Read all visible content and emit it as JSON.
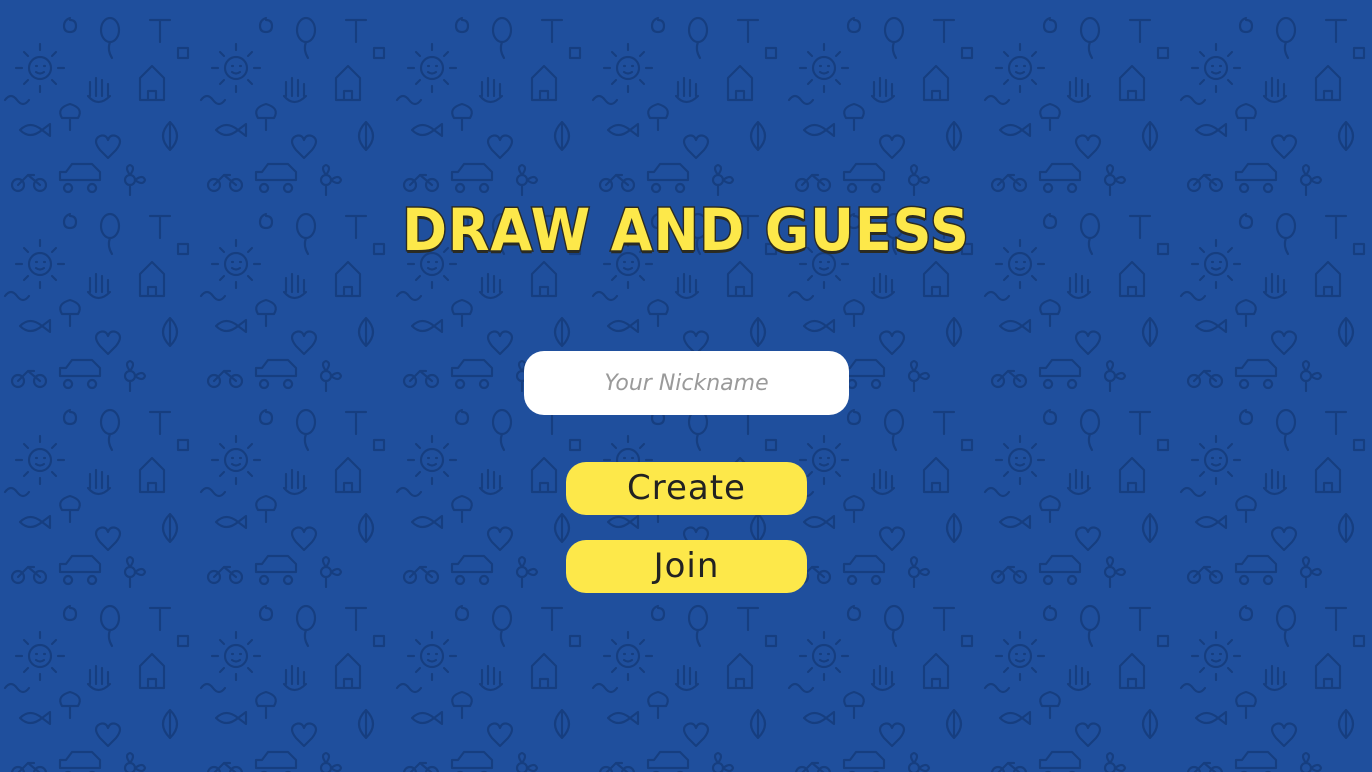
{
  "title": "DRAW AND GUESS",
  "nickname": {
    "placeholder": "Your Nickname",
    "value": ""
  },
  "buttons": {
    "create_label": "Create",
    "join_label": "Join"
  },
  "colors": {
    "background": "#1f4f9d",
    "doodle_stroke": "#163e80",
    "accent_yellow": "#fde84a",
    "input_bg": "#ffffff",
    "text_dark": "#222222"
  },
  "background_pattern": "hand-drawn doodle icons"
}
